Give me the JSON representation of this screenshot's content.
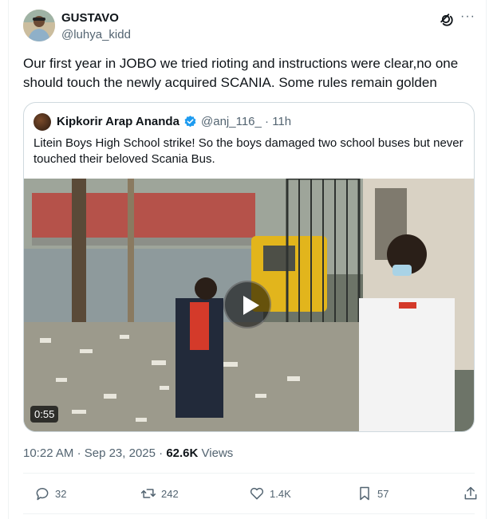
{
  "author": {
    "name": "GUSTAVO",
    "handle": "@luhya_kidd",
    "avatar_icon": "user-avatar"
  },
  "tweet": {
    "text": "Our first year in JOBO we tried rioting and instructions were clear,no one should touch the newly acquired SCANIA. Some rules remain golden"
  },
  "quote": {
    "name": "Kipkorir Arap Ananda",
    "handle": "@anj_116_",
    "separator": "·",
    "time": "11h",
    "text": "Litein Boys High School strike! So the boys damaged two school buses but never touched their beloved Scania Bus.",
    "video_duration": "0:55",
    "verified_color": "#1d9bf0"
  },
  "meta": {
    "time": "10:22 AM",
    "separator": "·",
    "date": "Sep 23, 2025",
    "views_count": "62.6K",
    "views_label": "Views"
  },
  "actions": {
    "replies": "32",
    "reposts": "242",
    "likes": "1.4K",
    "bookmarks": "57"
  },
  "colors": {
    "text": "#0f1419",
    "secondary": "#536471",
    "border": "#cfd9de",
    "accent": "#1d9bf0"
  }
}
